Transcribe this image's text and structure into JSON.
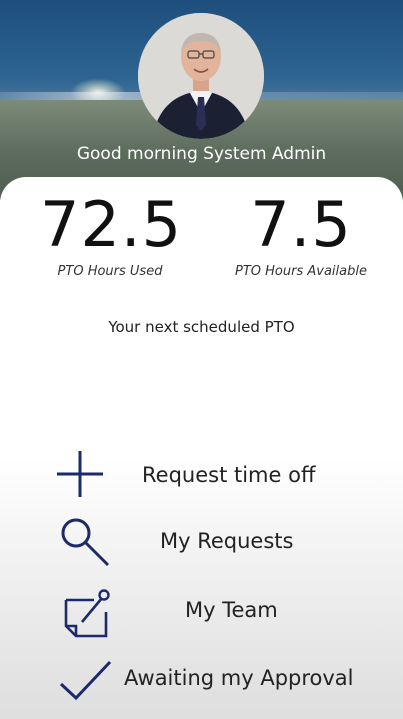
{
  "header": {
    "greeting": "Good morning System Admin"
  },
  "stats": {
    "used": {
      "value": "72.5",
      "label": "PTO Hours Used"
    },
    "available": {
      "value": "7.5",
      "label": "PTO Hours Available"
    }
  },
  "next_pto_label": "Your next scheduled PTO",
  "menu": {
    "items": [
      {
        "label": "Request time off",
        "icon": "plus-icon"
      },
      {
        "label": "My Requests",
        "icon": "search-icon"
      },
      {
        "label": "My Team",
        "icon": "edit-note-icon"
      },
      {
        "label": "Awaiting my Approval",
        "icon": "checkmark-icon"
      }
    ]
  },
  "colors": {
    "icon": "#1b2a6b",
    "text": "#222222"
  }
}
